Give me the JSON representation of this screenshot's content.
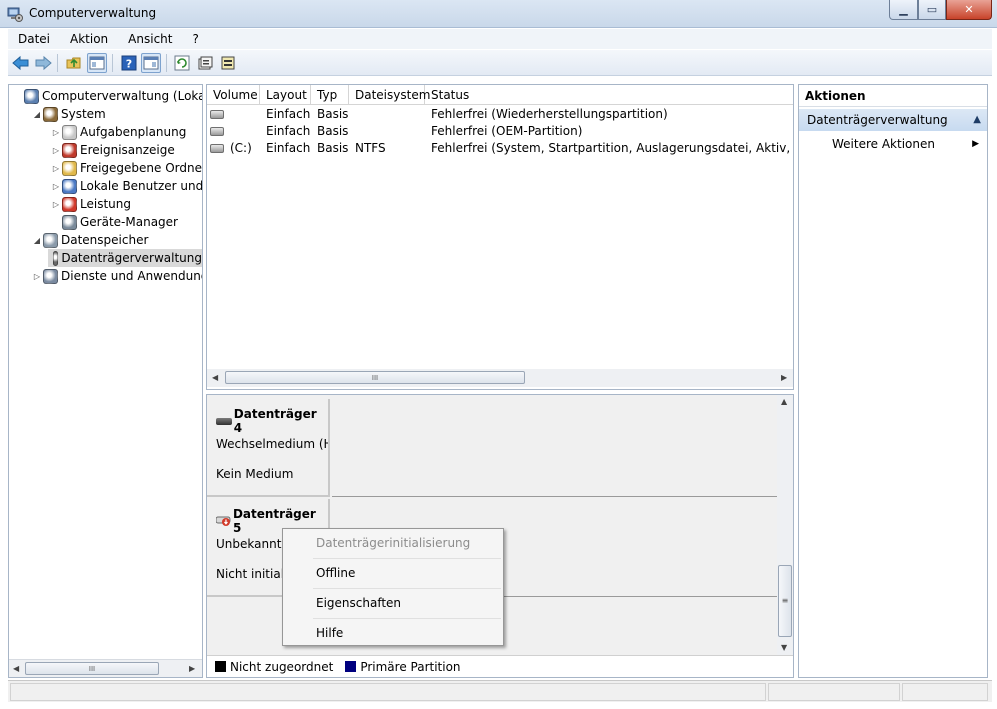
{
  "window": {
    "title": "Computerverwaltung"
  },
  "menu": [
    "Datei",
    "Aktion",
    "Ansicht",
    "?"
  ],
  "tree": {
    "items": [
      {
        "label": "Computerverwaltung (Lokal)",
        "icon": "computer-management-icon",
        "level": 0,
        "expander": ""
      },
      {
        "label": "System",
        "icon": "system-tools-icon",
        "level": 1,
        "expander": "expanded"
      },
      {
        "label": "Aufgabenplanung",
        "icon": "task-scheduler-icon",
        "level": 2,
        "expander": "collapsed"
      },
      {
        "label": "Ereignisanzeige",
        "icon": "event-viewer-icon",
        "level": 2,
        "expander": "collapsed"
      },
      {
        "label": "Freigegebene Ordner",
        "icon": "shared-folders-icon",
        "level": 2,
        "expander": "collapsed"
      },
      {
        "label": "Lokale Benutzer und Gr",
        "icon": "local-users-icon",
        "level": 2,
        "expander": "collapsed"
      },
      {
        "label": "Leistung",
        "icon": "performance-icon",
        "level": 2,
        "expander": "collapsed"
      },
      {
        "label": "Geräte-Manager",
        "icon": "device-manager-icon",
        "level": 2,
        "expander": ""
      },
      {
        "label": "Datenspeicher",
        "icon": "storage-icon",
        "level": 1,
        "expander": "expanded"
      },
      {
        "label": "Datenträgerverwaltung",
        "icon": "disk-management-icon",
        "level": 2,
        "expander": "",
        "selected": true
      },
      {
        "label": "Dienste und Anwendungen",
        "icon": "services-icon",
        "level": 1,
        "expander": "collapsed"
      }
    ]
  },
  "volumes": {
    "columns": [
      "Volume",
      "Layout",
      "Typ",
      "Dateisystem",
      "Status"
    ],
    "rows": [
      {
        "volume": "",
        "layout": "Einfach",
        "typ": "Basis",
        "fs": "",
        "status": "Fehlerfrei (Wiederherstellungspartition)"
      },
      {
        "volume": "",
        "layout": "Einfach",
        "typ": "Basis",
        "fs": "",
        "status": "Fehlerfrei (OEM-Partition)"
      },
      {
        "volume": "(C:)",
        "layout": "Einfach",
        "typ": "Basis",
        "fs": "NTFS",
        "status": "Fehlerfrei (System, Startpartition, Auslagerungsdatei, Aktiv, Absturzab"
      }
    ]
  },
  "disks": [
    {
      "name": "Datenträger 4",
      "type": "Wechselmedium (H",
      "state": "Kein Medium"
    },
    {
      "name": "Datenträger 5",
      "type": "Unbekannt",
      "state": "Nicht initiali"
    }
  ],
  "legend": [
    {
      "label": "Nicht zugeordnet",
      "color": "#000000"
    },
    {
      "label": "Primäre Partition",
      "color": "#00007f"
    }
  ],
  "context_menu": {
    "items": [
      {
        "label": "Datenträgerinitialisierung",
        "disabled": true
      },
      {
        "label": "Offline",
        "disabled": false
      },
      {
        "label": "Eigenschaften",
        "disabled": false
      },
      {
        "label": "Hilfe",
        "disabled": false
      }
    ]
  },
  "actions": {
    "header": "Aktionen",
    "section": "Datenträgerverwaltung",
    "item": "Weitere Aktionen"
  },
  "scroll_grip": "III",
  "scroll_grip_vertical": "≡"
}
